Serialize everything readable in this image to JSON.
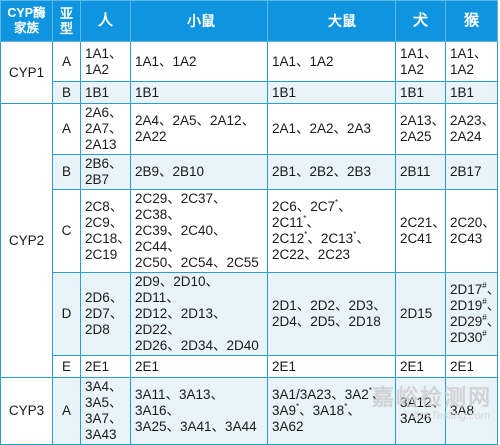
{
  "headers": {
    "family": "CYP酶家族",
    "subfamily": "亚型",
    "human": "人",
    "mouse": "小鼠",
    "rat": "大鼠",
    "dog": "犬",
    "monkey": "猴"
  },
  "families": [
    {
      "name": "CYP1",
      "rows": [
        {
          "subfamily": "A",
          "human": [
            "1A1、",
            "1A2"
          ],
          "mouse": [
            "1A1、1A2"
          ],
          "rat": [
            "1A1、1A2"
          ],
          "dog": [
            "1A1、",
            "1A2"
          ],
          "monkey": [
            "1A1、",
            "1A2"
          ]
        },
        {
          "subfamily": "B",
          "human": [
            "1B1"
          ],
          "mouse": [
            "1B1"
          ],
          "rat": [
            "1B1"
          ],
          "dog": [
            "1B1"
          ],
          "monkey": [
            "1B1"
          ]
        }
      ]
    },
    {
      "name": "CYP2",
      "rows": [
        {
          "subfamily": "A",
          "human": [
            "2A6、",
            "2A7、",
            "2A13"
          ],
          "mouse": [
            "2A4、2A5、2A12、",
            "2A22"
          ],
          "rat": [
            "2A1、2A2、2A3"
          ],
          "dog": [
            "2A13、",
            "2A25"
          ],
          "monkey": [
            "2A23、",
            "2A24"
          ]
        },
        {
          "subfamily": "B",
          "human": [
            "2B6、",
            "2B7"
          ],
          "mouse": [
            "2B9、2B10"
          ],
          "rat": [
            "2B1、2B2、2B3"
          ],
          "dog": [
            "2B11"
          ],
          "monkey": [
            "2B17"
          ]
        },
        {
          "subfamily": "C",
          "human": [
            "2C8、",
            "2C9、",
            "2C18、",
            "2C19"
          ],
          "mouse": [
            "2C29、2C37、2C38、",
            "2C39、2C40、2C44、",
            "2C50、2C54、2C55"
          ],
          "rat": [
            "2C6、2C7*、2C11*、",
            "2C12*、2C13*、",
            "2C22、2C23"
          ],
          "dog": [
            "2C21、",
            "2C41"
          ],
          "monkey": [
            "2C20、",
            "2C43"
          ]
        },
        {
          "subfamily": "D",
          "human": [
            "2D6、",
            "2D7、",
            "2D8"
          ],
          "mouse": [
            "2D9、2D10、2D11、",
            "2D12、2D13、2D22、",
            "2D26、2D34、2D40"
          ],
          "rat": [
            "2D1、2D2、2D3、",
            "2D4、2D5、2D18"
          ],
          "dog": [
            "2D15"
          ],
          "monkey": [
            "2D17#、",
            "2D19#、",
            "2D29#、",
            "2D30#"
          ]
        },
        {
          "subfamily": "E",
          "human": [
            "2E1"
          ],
          "mouse": [
            "2E1"
          ],
          "rat": [
            "2E1"
          ],
          "dog": [
            "2E1"
          ],
          "monkey": [
            "2E1"
          ]
        }
      ]
    },
    {
      "name": "CYP3",
      "rows": [
        {
          "subfamily": "A",
          "human": [
            "3A4、",
            "3A5、",
            "3A7、",
            "3A43"
          ],
          "mouse": [
            "3A11、3A13、3A16、",
            "3A25、3A41、3A44"
          ],
          "rat": [
            "3A1/3A23、3A2*、",
            "3A9*、3A18*、",
            "3A62"
          ],
          "dog": [
            "3A12、",
            "3A26"
          ],
          "monkey": [
            "3A8"
          ]
        }
      ]
    }
  ],
  "watermark": {
    "cn": "嘉峪检测网",
    "en": "AnyTesting.com"
  }
}
